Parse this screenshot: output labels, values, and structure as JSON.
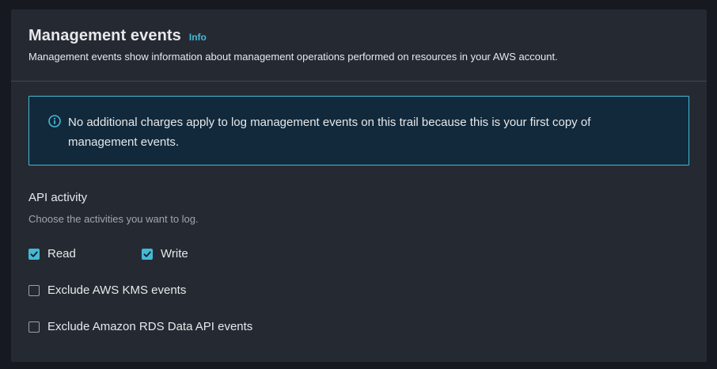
{
  "header": {
    "title": "Management events",
    "info_link": "Info",
    "description": "Management events show information about management operations performed on resources in your AWS account."
  },
  "alert": {
    "icon": "info-circle-icon",
    "text": "No additional charges apply to log management events on this trail because this is your first copy of management events."
  },
  "api_activity": {
    "label": "API activity",
    "description": "Choose the activities you want to log.",
    "options": [
      {
        "label": "Read",
        "checked": true
      },
      {
        "label": "Write",
        "checked": true
      }
    ]
  },
  "exclusions": [
    {
      "label": "Exclude AWS KMS events",
      "checked": false
    },
    {
      "label": "Exclude Amazon RDS Data API events",
      "checked": false
    }
  ],
  "colors": {
    "accent": "#44b9d6",
    "panel_bg": "#252a32",
    "alert_bg": "#12293b",
    "page_bg": "#16191f"
  }
}
